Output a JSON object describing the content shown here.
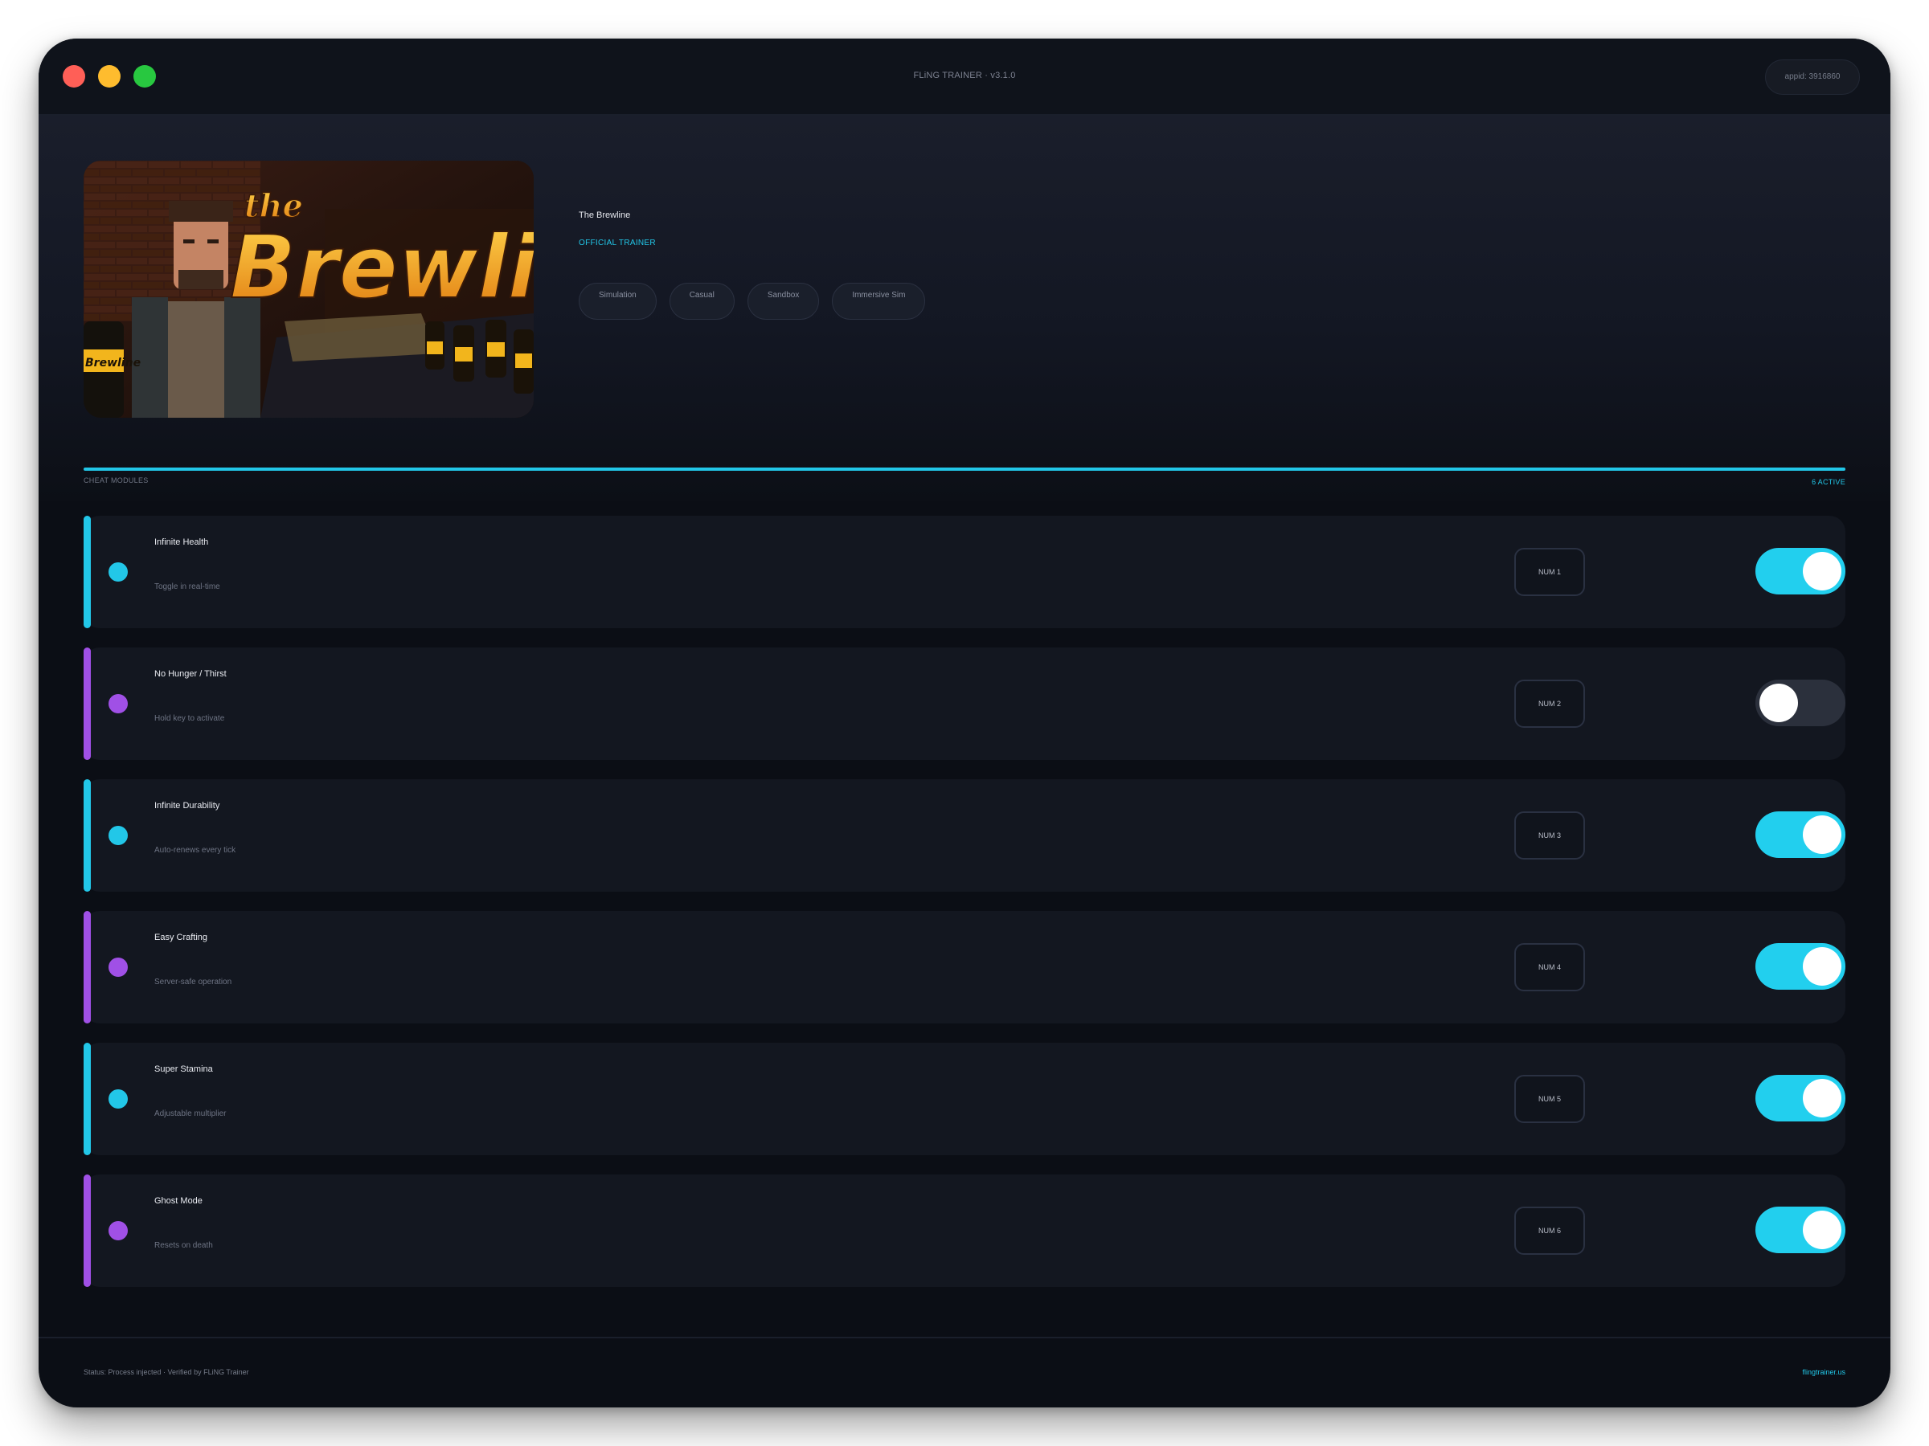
{
  "window": {
    "title": "FLiNG TRAINER · v3.1.0",
    "appid": "appid: 3916860"
  },
  "game": {
    "title": "The Brewline",
    "badge": "OFFICIAL TRAINER",
    "cover_text": "the Brewline",
    "tags": [
      "Simulation",
      "Casual",
      "Sandbox",
      "Immersive Sim"
    ]
  },
  "section": {
    "label": "CHEAT MODULES",
    "active_count": "6 ACTIVE"
  },
  "cheats": [
    {
      "name": "Infinite Health",
      "description": "Toggle in real-time",
      "hotkey": "NUM 1",
      "enabled": true,
      "accent": "#22c7e8"
    },
    {
      "name": "No Hunger / Thirst",
      "description": "Hold key to activate",
      "hotkey": "NUM 2",
      "enabled": false,
      "accent": "#a050e6"
    },
    {
      "name": "Infinite Durability",
      "description": "Auto-renews every tick",
      "hotkey": "NUM 3",
      "enabled": true,
      "accent": "#22c7e8"
    },
    {
      "name": "Easy Crafting",
      "description": "Server-safe operation",
      "hotkey": "NUM 4",
      "enabled": true,
      "accent": "#a050e6"
    },
    {
      "name": "Super Stamina",
      "description": "Adjustable multiplier",
      "hotkey": "NUM 5",
      "enabled": true,
      "accent": "#22c7e8"
    },
    {
      "name": "Ghost Mode",
      "description": "Resets on death",
      "hotkey": "NUM 6",
      "enabled": true,
      "accent": "#a050e6"
    }
  ],
  "footer": {
    "status": "Status: Process injected · Verified by FLiNG Trainer",
    "site": "flingtrainer.us"
  },
  "colors": {
    "accent_cyan": "#22c7e8",
    "accent_purple": "#a050e6",
    "toggle_on": "#22cfee",
    "toggle_off": "#2b303c",
    "background": "#0b0e15"
  }
}
